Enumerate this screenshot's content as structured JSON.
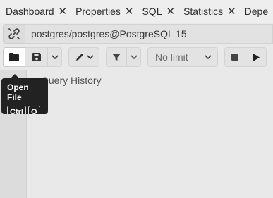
{
  "tabs": [
    {
      "label": "Dashboard"
    },
    {
      "label": "Properties"
    },
    {
      "label": "SQL"
    },
    {
      "label": "Statistics"
    },
    {
      "label": "Depe"
    }
  ],
  "connection": {
    "label": "postgres/postgres@PostgreSQL 15",
    "icon": "link-icon"
  },
  "toolbar": {
    "limit_label": "No limit",
    "icons": [
      "folder-icon",
      "save-icon",
      "pen-icon",
      "filter-icon",
      "stop-icon",
      "play-icon"
    ]
  },
  "history": {
    "label": "Query History"
  },
  "tooltip": {
    "title": "Open File",
    "keys": [
      "Ctrl",
      "O"
    ]
  },
  "colors": {
    "tooltip_bg": "#222222",
    "toolbar_bg": "#e3e3e3",
    "page_bg": "#e9e9e9"
  }
}
